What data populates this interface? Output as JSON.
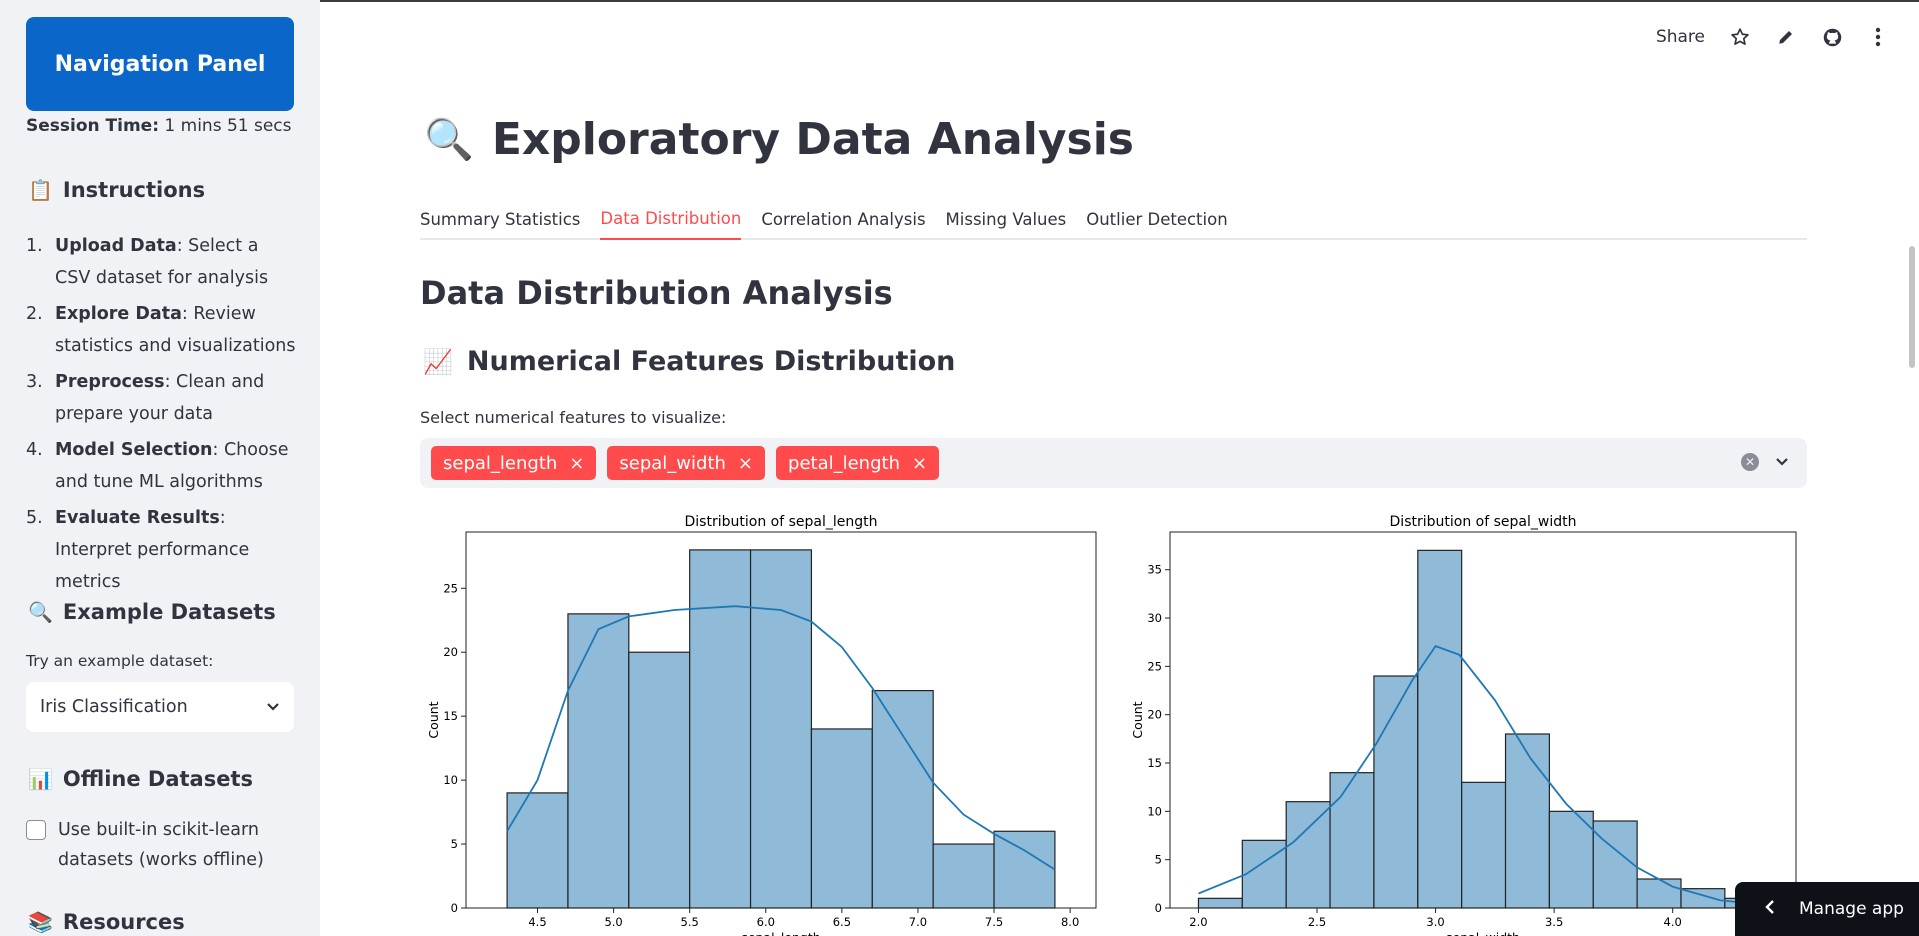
{
  "sidebar": {
    "nav_title": "Navigation Panel",
    "session_label": "Session Time:",
    "session_value": "1 mins 51 secs",
    "instructions_heading": "Instructions",
    "instructions": [
      {
        "num": "1.",
        "bold": "Upload Data",
        "text": ": Select a CSV dataset for analysis"
      },
      {
        "num": "2.",
        "bold": "Explore Data",
        "text": ": Review statistics and visualizations"
      },
      {
        "num": "3.",
        "bold": "Preprocess",
        "text": ": Clean and prepare your data"
      },
      {
        "num": "4.",
        "bold": "Model Selection",
        "text": ": Choose and tune ML algorithms"
      },
      {
        "num": "5.",
        "bold": "Evaluate Results",
        "text": ": Interpret performance metrics"
      }
    ],
    "example_heading": "Example Datasets",
    "try_label": "Try an example dataset:",
    "dataset_selected": "Iris Classification",
    "offline_heading": "Offline Datasets",
    "offline_checkbox_label": "Use built-in scikit-learn datasets (works offline)",
    "offline_checked": false,
    "resources_heading": "Resources"
  },
  "topbar": {
    "share_label": "Share"
  },
  "main": {
    "title": "Exploratory Data Analysis",
    "tabs": [
      "Summary Statistics",
      "Data Distribution",
      "Correlation Analysis",
      "Missing Values",
      "Outlier Detection"
    ],
    "active_tab": "Data Distribution",
    "section_title": "Data Distribution Analysis",
    "subsection_title": "Numerical Features Distribution",
    "multiselect_label": "Select numerical features to visualize:",
    "selected_features": [
      "sepal_length",
      "sepal_width",
      "petal_length"
    ]
  },
  "manage_app_label": "Manage app",
  "colors": {
    "accent": "#ff4b4b",
    "nav_button": "#0a66c8",
    "sidebar_bg": "#f0f2f6",
    "bar_fill": "#8fbbd9",
    "kde_line": "#1f77b4"
  },
  "chart_data": [
    {
      "type": "bar",
      "title": "Distribution of sepal_length",
      "xlabel": "sepal_length",
      "ylabel": "Count",
      "bin_edges": [
        4.3,
        4.7,
        5.1,
        5.5,
        5.9,
        6.3,
        6.7,
        7.1,
        7.5,
        7.9
      ],
      "values": [
        9,
        23,
        20,
        28,
        28,
        14,
        17,
        5,
        6
      ],
      "kde": [
        [
          4.3,
          6
        ],
        [
          4.5,
          10
        ],
        [
          4.7,
          17
        ],
        [
          4.9,
          21.8
        ],
        [
          5.1,
          22.8
        ],
        [
          5.4,
          23.3
        ],
        [
          5.8,
          23.6
        ],
        [
          6.1,
          23.3
        ],
        [
          6.3,
          22.4
        ],
        [
          6.5,
          20.4
        ],
        [
          6.7,
          17.2
        ],
        [
          6.9,
          13.5
        ],
        [
          7.1,
          9.8
        ],
        [
          7.3,
          7.3
        ],
        [
          7.5,
          5.8
        ],
        [
          7.7,
          4.5
        ],
        [
          7.9,
          3
        ]
      ],
      "xlim": [
        4.03,
        8.17
      ],
      "ylim": [
        0,
        29.4
      ],
      "xticks": [
        "4.5",
        "5.0",
        "5.5",
        "6.0",
        "6.5",
        "7.0",
        "7.5",
        "8.0"
      ],
      "xtick_values": [
        4.5,
        5.0,
        5.5,
        6.0,
        6.5,
        7.0,
        7.5,
        8.0
      ],
      "yticks": [
        "0",
        "5",
        "10",
        "15",
        "20",
        "25"
      ],
      "ytick_values": [
        0,
        5,
        10,
        15,
        20,
        25
      ]
    },
    {
      "type": "bar",
      "title": "Distribution of sepal_width",
      "xlabel": "sepal_width",
      "ylabel": "Count",
      "bin_edges": [
        2.0,
        2.185,
        2.37,
        2.555,
        2.74,
        2.925,
        3.11,
        3.295,
        3.48,
        3.665,
        3.85,
        4.035,
        4.22,
        4.4
      ],
      "values": [
        1,
        7,
        11,
        14,
        24,
        37,
        13,
        18,
        10,
        9,
        3,
        2,
        1
      ],
      "kde": [
        [
          2.0,
          1.5
        ],
        [
          2.2,
          3.5
        ],
        [
          2.4,
          6.8
        ],
        [
          2.6,
          11.5
        ],
        [
          2.75,
          17
        ],
        [
          2.9,
          23.5
        ],
        [
          3.0,
          27.1
        ],
        [
          3.1,
          26.2
        ],
        [
          3.25,
          21.5
        ],
        [
          3.4,
          15.5
        ],
        [
          3.55,
          10.8
        ],
        [
          3.7,
          7.2
        ],
        [
          3.85,
          4.2
        ],
        [
          4.0,
          2.2
        ],
        [
          4.2,
          0.8
        ],
        [
          4.4,
          0.3
        ]
      ],
      "xlim": [
        1.88,
        4.52
      ],
      "ylim": [
        0,
        38.9
      ],
      "xticks": [
        "2.0",
        "2.5",
        "3.0",
        "3.5",
        "4.0"
      ],
      "xtick_values": [
        2.0,
        2.5,
        3.0,
        3.5,
        4.0
      ],
      "yticks": [
        "0",
        "5",
        "10",
        "15",
        "20",
        "25",
        "30",
        "35"
      ],
      "ytick_values": [
        0,
        5,
        10,
        15,
        20,
        25,
        30,
        35
      ]
    }
  ]
}
